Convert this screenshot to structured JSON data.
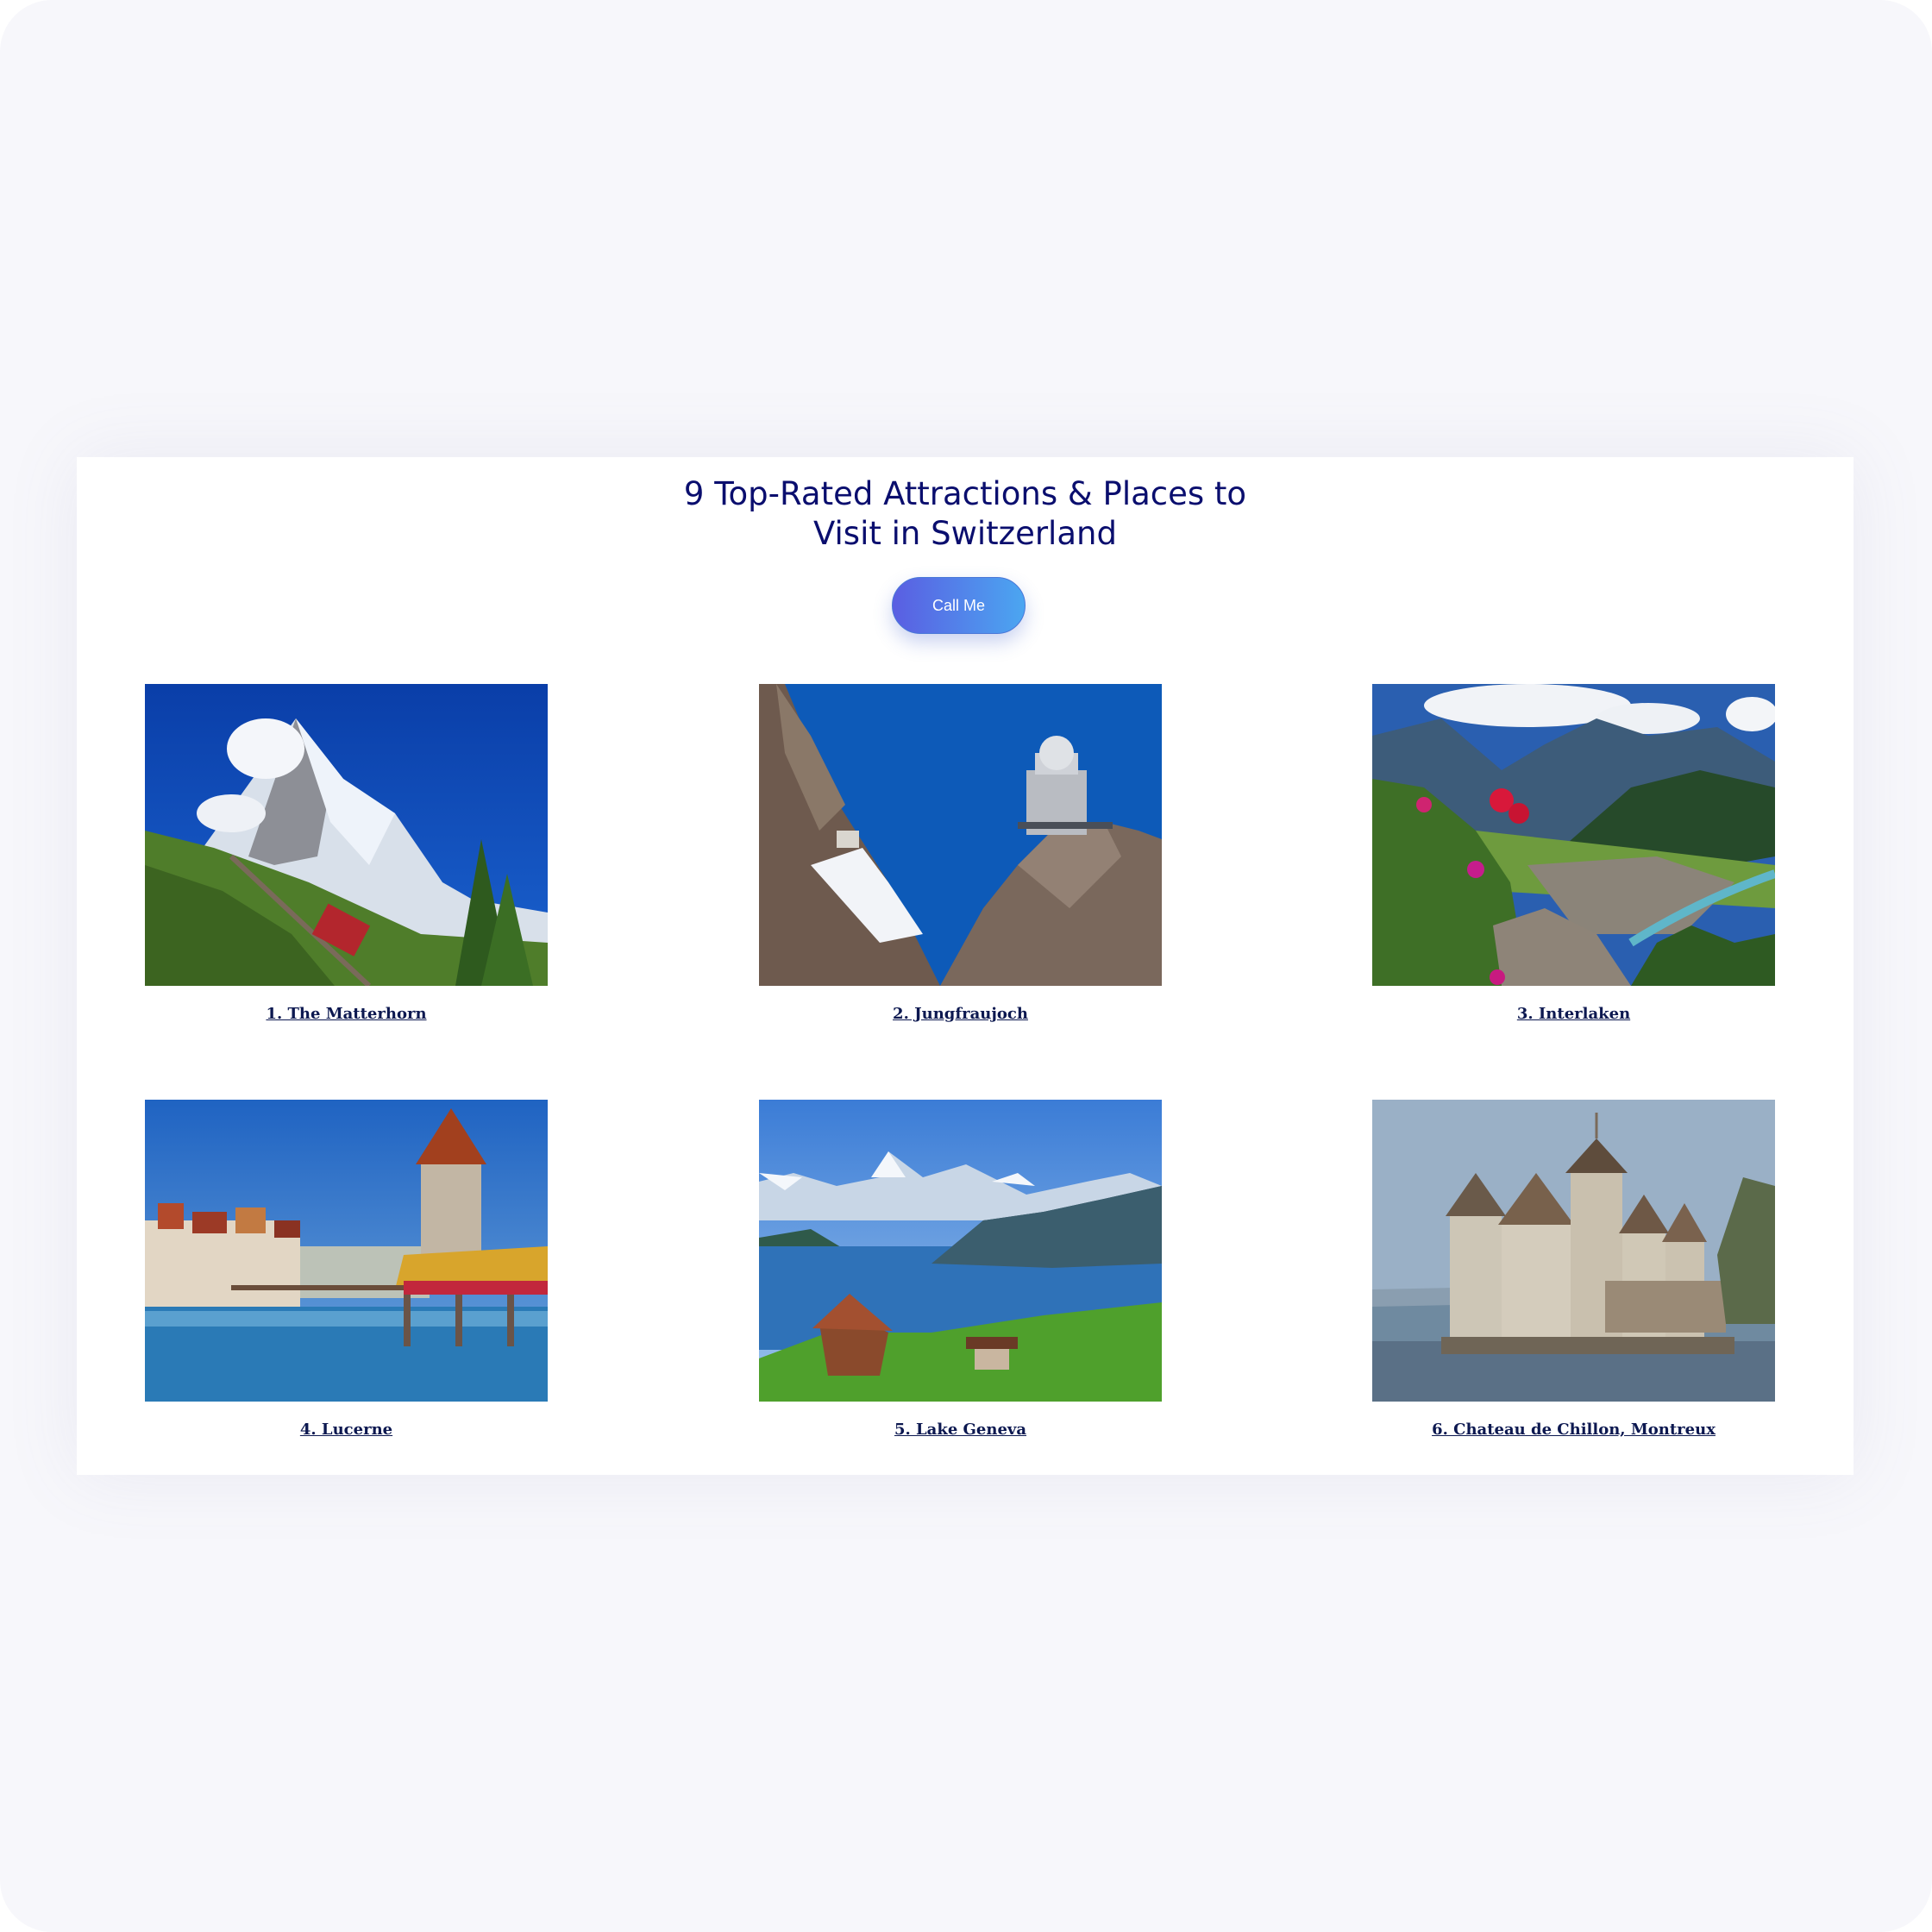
{
  "heading": {
    "line1": "9 Top-Rated Attractions & Places to",
    "line2": "Visit in Switzerland"
  },
  "cta": {
    "label": "Call Me"
  },
  "attractions": [
    {
      "title": "1. The Matterhorn"
    },
    {
      "title": "2. Jungfraujoch"
    },
    {
      "title": "3. Interlaken"
    },
    {
      "title": "4. Lucerne"
    },
    {
      "title": "5. Lake Geneva"
    },
    {
      "title": "6. Chateau de Chillon, Montreux"
    }
  ],
  "colors": {
    "background": "#f7f7fb",
    "heading": "#0a0e6e",
    "caption": "#0c1850",
    "button_start": "#5a5ee2",
    "button_end": "#4ba6f1"
  }
}
